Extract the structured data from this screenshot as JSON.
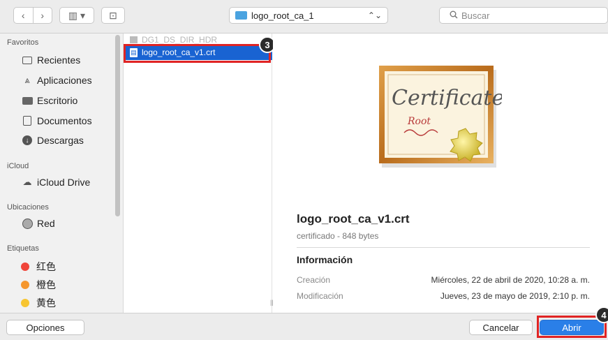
{
  "toolbar": {
    "back_glyph": "‹",
    "forward_glyph": "›",
    "view_glyph": "▥ ▾",
    "new_folder_glyph": "⊡",
    "path_label": "logo_root_ca_1",
    "path_chevron": "⌃⌄",
    "search_placeholder": "Buscar",
    "search_icon": "search-icon"
  },
  "sidebar": {
    "sections": [
      {
        "title": "Favoritos"
      },
      {
        "title": "iCloud"
      },
      {
        "title": "Ubicaciones"
      },
      {
        "title": "Etiquetas"
      }
    ],
    "favorites": [
      {
        "label": "Recientes",
        "icon": "clock-icon"
      },
      {
        "label": "Aplicaciones",
        "icon": "applications-icon"
      },
      {
        "label": "Escritorio",
        "icon": "desktop-icon"
      },
      {
        "label": "Documentos",
        "icon": "documents-icon"
      },
      {
        "label": "Descargas",
        "icon": "downloads-icon"
      }
    ],
    "icloud": [
      {
        "label": "iCloud Drive",
        "icon": "cloud-icon"
      }
    ],
    "locations": [
      {
        "label": "Red",
        "icon": "network-icon"
      }
    ],
    "tags": [
      {
        "label": "红色",
        "color": "#f0453a"
      },
      {
        "label": "橙色",
        "color": "#f5962d"
      },
      {
        "label": "黄色",
        "color": "#f7c531"
      }
    ]
  },
  "files": {
    "faded_item": "DG1_DS_DIR_HDR",
    "selected_item": "logo_root_ca_v1.crt",
    "selected_color": "#1963d2"
  },
  "annotations": {
    "badge_3": "3",
    "badge_4": "4",
    "box_color": "#e02424"
  },
  "preview": {
    "cert_title": "Certificate",
    "cert_subtitle": "Root",
    "filename": "logo_root_ca_v1.crt",
    "meta": "certificado - 848 bytes",
    "info_title": "Información",
    "rows": [
      {
        "key": "Creación",
        "value": "Miércoles, 22 de abril de 2020, 10:28 a. m."
      },
      {
        "key": "Modificación",
        "value": "Jueves, 23 de mayo de 2019, 2:10 p. m."
      }
    ]
  },
  "buttons": {
    "options": "Opciones",
    "cancel": "Cancelar",
    "open": "Abrir"
  }
}
